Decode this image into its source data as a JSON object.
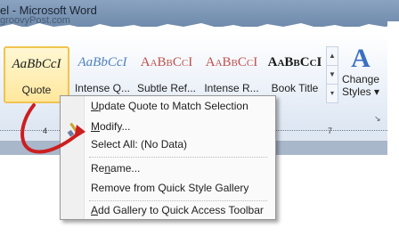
{
  "window": {
    "title": "el - Microsoft Word",
    "watermark": "groovyPost.com"
  },
  "gallery": {
    "styles": [
      {
        "preview": "AaBbCcI",
        "label": "Quote",
        "preview_color": "#1a1a1a",
        "italic": true,
        "selected": true
      },
      {
        "preview": "AaBbCcI",
        "label": "Intense Q...",
        "preview_color": "#4f81bd",
        "italic": true,
        "selected": false
      },
      {
        "preview": "AaBbCcI",
        "label": "Subtle Ref...",
        "preview_color": "#c0504d",
        "italic": false,
        "selected": false
      },
      {
        "preview": "AaBbCcI",
        "label": "Intense R...",
        "preview_color": "#c0504d",
        "italic": false,
        "selected": false
      },
      {
        "preview": "AaBbCcI",
        "label": "Book Title",
        "preview_color": "#1a1a1a",
        "italic": false,
        "selected": false
      }
    ]
  },
  "change_styles": {
    "line1": "Change",
    "line2": "Styles ▾"
  },
  "ruler": {
    "numbers": [
      "4",
      "7"
    ]
  },
  "context_menu": {
    "update": {
      "accel": "U",
      "rest": "pdate Quote to Match Selection"
    },
    "modify": {
      "accel": "M",
      "rest": "odify..."
    },
    "select_all": "Select All: (No Data)",
    "rename": {
      "pre": "Re",
      "accel": "n",
      "post": "ame..."
    },
    "remove": "Remove from Quick Style Gallery",
    "add_gallery": {
      "accel": "A",
      "rest": "dd Gallery to Quick Access Toolbar"
    }
  },
  "colors": {
    "annotation_arrow": "#cc1f1f",
    "selected_cell": "#f0c350"
  }
}
